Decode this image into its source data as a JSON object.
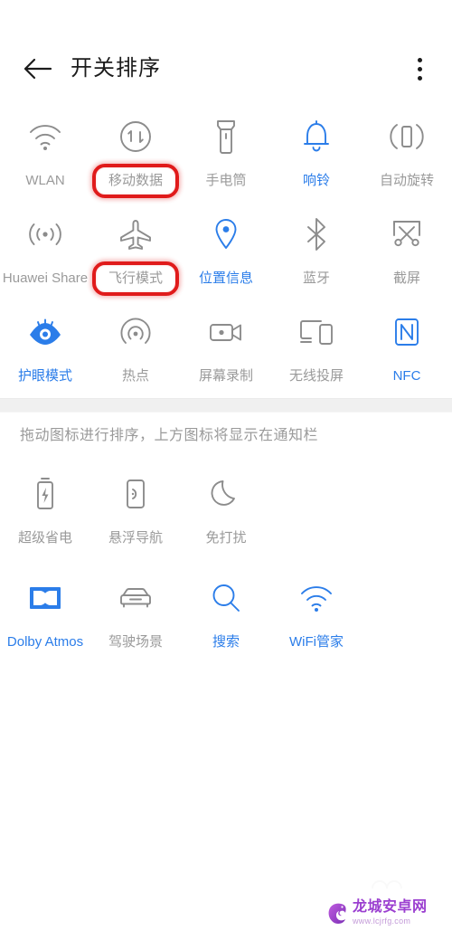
{
  "header": {
    "title": "开关排序",
    "back_icon": "arrow-left-icon",
    "menu_icon": "more-vertical-icon"
  },
  "colors": {
    "accent_blue": "#2b7de9",
    "inactive_gray": "#9a9a9a",
    "icon_gray": "#8c8c8c",
    "highlight_red": "#e01b1b",
    "band_gray": "#f0f0f0",
    "title_black": "#1c1c1c"
  },
  "hint": "拖动图标进行排序，上方图标将显示在通知栏",
  "top_tiles": [
    {
      "label": "WLAN",
      "icon": "wifi-icon",
      "active": false,
      "highlighted": false
    },
    {
      "label": "移动数据",
      "icon": "mobile-data-icon",
      "active": false,
      "highlighted": true
    },
    {
      "label": "手电筒",
      "icon": "flashlight-icon",
      "active": false,
      "highlighted": false
    },
    {
      "label": "响铃",
      "icon": "bell-icon",
      "active": true,
      "highlighted": false
    },
    {
      "label": "自动旋转",
      "icon": "auto-rotate-icon",
      "active": false,
      "highlighted": false
    },
    {
      "label": "Huawei Share",
      "icon": "huawei-share-icon",
      "active": false,
      "highlighted": false
    },
    {
      "label": "飞行模式",
      "icon": "airplane-icon",
      "active": false,
      "highlighted": true
    },
    {
      "label": "位置信息",
      "icon": "location-pin-icon",
      "active": true,
      "highlighted": false
    },
    {
      "label": "蓝牙",
      "icon": "bluetooth-icon",
      "active": false,
      "highlighted": false
    },
    {
      "label": "截屏",
      "icon": "screenshot-icon",
      "active": false,
      "highlighted": false
    },
    {
      "label": "护眼模式",
      "icon": "eye-comfort-icon",
      "active": true,
      "highlighted": false
    },
    {
      "label": "热点",
      "icon": "hotspot-icon",
      "active": false,
      "highlighted": false
    },
    {
      "label": "屏幕录制",
      "icon": "screen-record-icon",
      "active": false,
      "highlighted": false
    },
    {
      "label": "无线投屏",
      "icon": "cast-screen-icon",
      "active": false,
      "highlighted": false
    },
    {
      "label": "NFC",
      "icon": "nfc-icon",
      "active": true,
      "highlighted": false
    }
  ],
  "bottom_tiles": [
    {
      "label": "超级省电",
      "icon": "battery-saver-icon",
      "active": false,
      "highlighted": false
    },
    {
      "label": "悬浮导航",
      "icon": "floating-nav-icon",
      "active": false,
      "highlighted": false
    },
    {
      "label": "免打扰",
      "icon": "moon-icon",
      "active": false,
      "highlighted": false
    }
  ],
  "extra_tiles": [
    {
      "label": "Dolby Atmos",
      "icon": "dolby-atmos-icon",
      "active": true,
      "highlighted": false
    },
    {
      "label": "驾驶场景",
      "icon": "car-icon",
      "active": false,
      "highlighted": false
    },
    {
      "label": "搜索",
      "icon": "search-icon",
      "active": true,
      "highlighted": false
    },
    {
      "label": "WiFi管家",
      "icon": "wifi-manager-icon",
      "active": true,
      "highlighted": false
    }
  ],
  "watermark": {
    "name": "龙城安卓网",
    "url": "www.lcjrfg.com",
    "logo_icon": "dragon-logo-icon"
  }
}
